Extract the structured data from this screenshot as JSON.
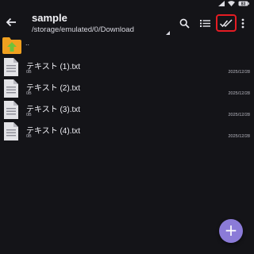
{
  "status_bar": {
    "battery_label": "83"
  },
  "app_bar": {
    "title": "sample",
    "path": "/storage/emulated/0/Download",
    "icons": [
      "back-arrow-icon",
      "search-icon",
      "list-view-icon",
      "select-all-icon",
      "more-vert-icon"
    ],
    "select_all_highlight_color": "#e51c23"
  },
  "parent_entry": {
    "label": "..",
    "icon": "folder-up-icon",
    "folder_color": "#f0a020",
    "arrow_color": "#6fc23a"
  },
  "files": [
    {
      "name": "テキスト (1).txt",
      "size": "0B",
      "date": "2025/12/28"
    },
    {
      "name": "テキスト (2).txt",
      "size": "0B",
      "date": "2025/12/28"
    },
    {
      "name": "テキスト (3).txt",
      "size": "0B",
      "date": "2025/12/28"
    },
    {
      "name": "テキスト (4).txt",
      "size": "0B",
      "date": "2025/12/28"
    }
  ],
  "fab": {
    "icon": "plus-icon",
    "label": "+",
    "color": "#8b7bd8"
  }
}
